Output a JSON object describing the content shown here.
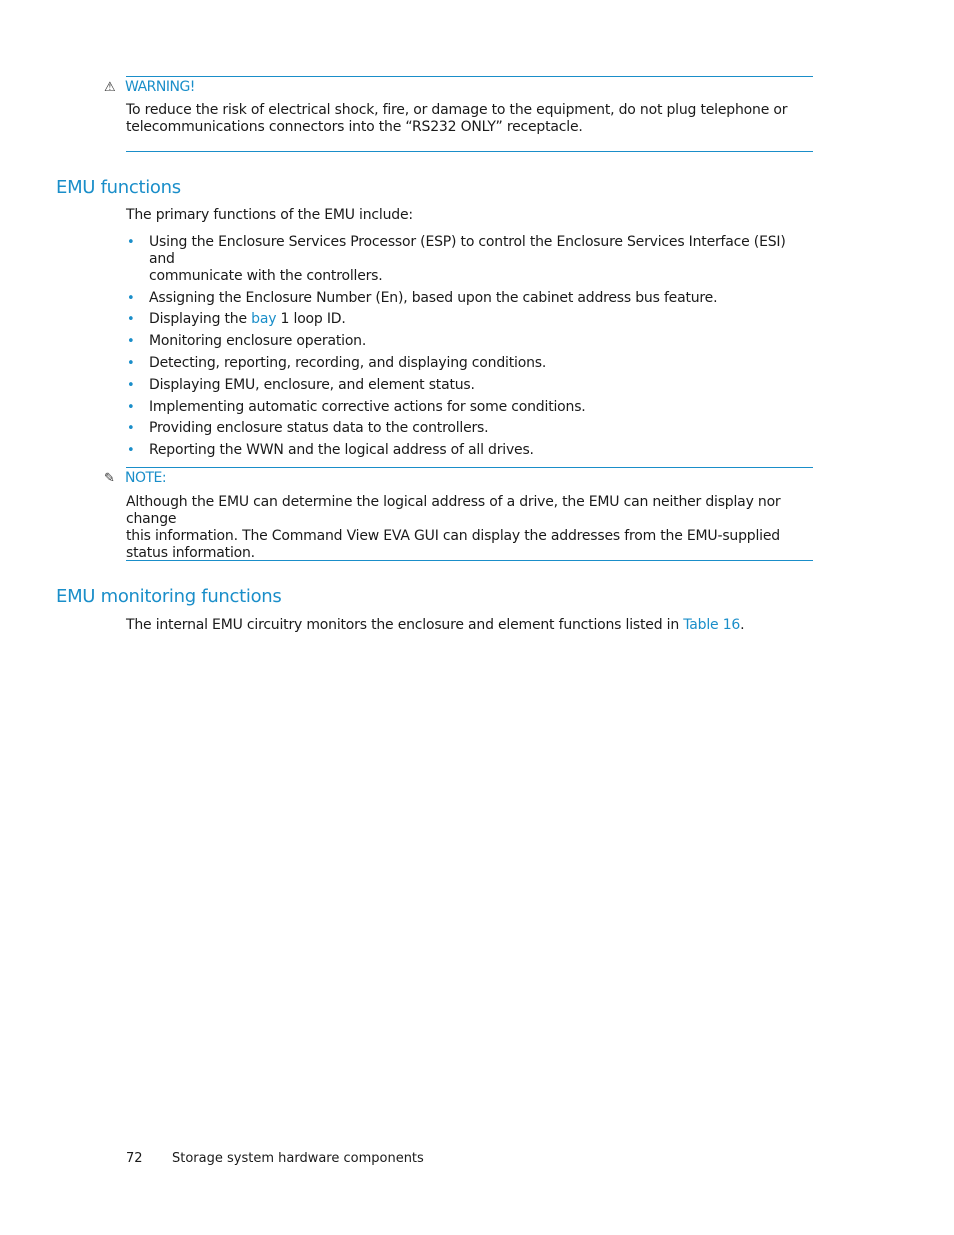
{
  "warning": {
    "icon": "warning-triangle-icon",
    "icon_glyph": "⚠",
    "label": "WARNING!",
    "text_line1": "To reduce the risk of electrical shock, fire, or damage to the equipment, do not plug telephone or",
    "text_line2": "telecommunications connectors into the “RS232 ONLY” receptacle."
  },
  "emu_functions": {
    "title": "EMU functions",
    "intro": "The primary functions of the EMU include:",
    "bullet_glyph": "•",
    "items": [
      {
        "line1": "Using the Enclosure Services Processor (ESP) to control the Enclosure Services Interface (ESI) and",
        "line2": "communicate with the controllers."
      },
      {
        "text": "Assigning the Enclosure Number (En), based upon the cabinet address bus feature."
      },
      {
        "before": "Displaying the ",
        "link": "bay",
        "after": " 1 loop ID."
      },
      {
        "text": "Monitoring enclosure operation."
      },
      {
        "text": "Detecting, reporting, recording, and displaying conditions."
      },
      {
        "text": "Displaying EMU, enclosure, and element status."
      },
      {
        "text": "Implementing automatic corrective actions for some conditions."
      },
      {
        "text": "Providing enclosure status data to the controllers."
      },
      {
        "text": "Reporting the WWN and the logical address of all drives."
      }
    ]
  },
  "note": {
    "icon": "note-pencil-icon",
    "icon_glyph": "✎",
    "label": "NOTE:",
    "line1": "Although the EMU can determine the logical address of a drive, the EMU can neither display nor change",
    "line2": "this information.  The Command View EVA GUI can display the addresses from the EMU-supplied",
    "line3": "status information."
  },
  "emu_monitoring": {
    "title": "EMU monitoring functions",
    "text_before": "The internal EMU circuitry monitors the enclosure and element functions listed in ",
    "link": "Table 16",
    "text_after": "."
  },
  "footer": {
    "page_number": "72",
    "chapter": "Storage system hardware components"
  },
  "colors": {
    "accent": "#1a8ec9",
    "text": "#1a1a1a"
  }
}
